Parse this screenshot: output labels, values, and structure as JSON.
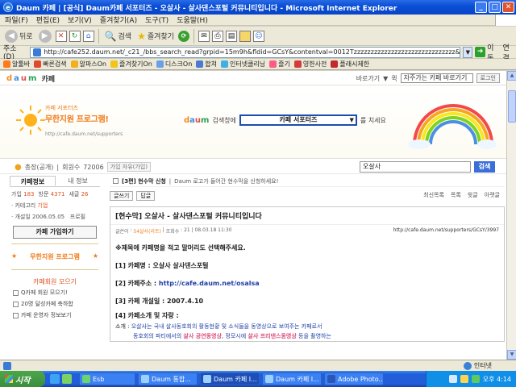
{
  "window": {
    "title": "Daum 카페 | [공식] Daum카페 서포터즈 - 오살사 - 살사댄스포털 커뮤니티입니다 - Microsoft Internet Explorer",
    "min": "_",
    "max": "□",
    "close": "✕"
  },
  "menu": [
    "파일(F)",
    "편집(E)",
    "보기(V)",
    "즐겨찾기(A)",
    "도구(T)",
    "도움말(H)"
  ],
  "toolbar": {
    "back": "뒤로",
    "search": "검색",
    "favorites": "즐겨찾기"
  },
  "address": {
    "label": "주소(D)",
    "url": "http://cafe252.daum.net/_c21_/bbs_search_read?grpid=15m9h&fldid=GCsY&contentval=0012Tzzzzzzzzzzzzzzzzzzzzzzzzzzzzzz&nenc=Hv7cpn_Jcjj",
    "go": "이동",
    "links": "연결"
  },
  "links": [
    "알툴바",
    "빠른검색",
    "알파스On",
    "즐겨찾기On",
    "디스크On",
    "합쳐",
    "인터넷클리닝",
    "즐기",
    "영한사전",
    "플래시제한"
  ],
  "daum": {
    "logo": [
      "d",
      "a",
      "u",
      "m"
    ],
    "cafe": "카페",
    "goto": "바로가기",
    "goto_sel": "자주가는 카페 바로가기",
    "login": "로그인"
  },
  "banner": {
    "slogan1": "카페 서포터즈",
    "slogan2": "무한지원 프로그램!",
    "url": "http://cafe.daum.net/supporters",
    "search_logo": "daum",
    "search_label": "검색창에",
    "cafe_select": "카페 서포터즈",
    "search_hint": "를 치세요"
  },
  "info": {
    "owner": "총장(공개)",
    "members_label": "회원수",
    "members": "72006",
    "badge": "가입 자유(가입)",
    "search_value": "오살사",
    "search_btn": "검색"
  },
  "sidebar": {
    "tabs": [
      "카페정보",
      "내 정보"
    ],
    "stats": [
      {
        "label": "가입",
        "value": "183"
      },
      {
        "label": "방문",
        "value": "4371"
      },
      {
        "label": "새글",
        "value": "26"
      }
    ],
    "category_label": "카테고리",
    "category_value": "기업",
    "open_label": "개설일",
    "open_value": "2006.05.05",
    "profile": "프로필",
    "join_btn": "카페 가입하기",
    "menu_title": "무한지원 프로그램",
    "member_title": "카페회원 모으기",
    "items": [
      "Q카페 회원 모으기!",
      "20명 달성카페 축하합",
      "카페 운영자 정보보기"
    ]
  },
  "content": {
    "notice_tag": "[3편] 현수막 신청",
    "notice_text": "Daum 로고가 들어간 현수막을 신청하세요!",
    "list_btn": "글쓰기",
    "reply_btn": "답글",
    "right_actions": [
      "최신목록",
      "목록",
      "윗글",
      "아랫글"
    ],
    "post_title": "[현수막] 오살사 - 살사댄스포털 커뮤니티입니다",
    "author_label": "글쓴이",
    "author": "54살사(리트)",
    "views_label": "조회수",
    "views": "21",
    "date": "08.03.18 11:30",
    "post_url": "http://cafe.daum.net/supporters/GCsY/3997",
    "body": {
      "line1": "※제목에 카페명을 적고 말머리도 선택해주세요.",
      "line2_label": "[1] 카페명 : ",
      "line2_value": "오살사 살사댄스포털",
      "line3_label": "[2] 카페주소 : ",
      "line3_value": "http://cafe.daum.net/osalsa",
      "line4_label": "[3] 카페 개설일 : ",
      "line4_value": "2007.4.10",
      "line5": "[4] 카페소개 및 자랑 :",
      "intro_prefix": "소개 : ",
      "intro1": "오살사는 국내 살사동호회의 활동현황 및 소식들을 동영상으로 보여주는 카페로서",
      "intro2_a": "동호회의 파티에서의 ",
      "intro2_b": "살사 공연동영상",
      "intro2_c": ", 정모시에 ",
      "intro2_d": "살사 프리댄스동영상",
      "intro2_e": " 등을 촬영하는"
    }
  },
  "status": {
    "zone": "인터넷"
  },
  "taskbar": {
    "start": "시작",
    "tasks": [
      "Esb",
      "Daum 통합...",
      "Daum 카페 I...",
      "Daum 카페 I...",
      "Adobe Photo..."
    ],
    "clock": "오후 4:14"
  }
}
